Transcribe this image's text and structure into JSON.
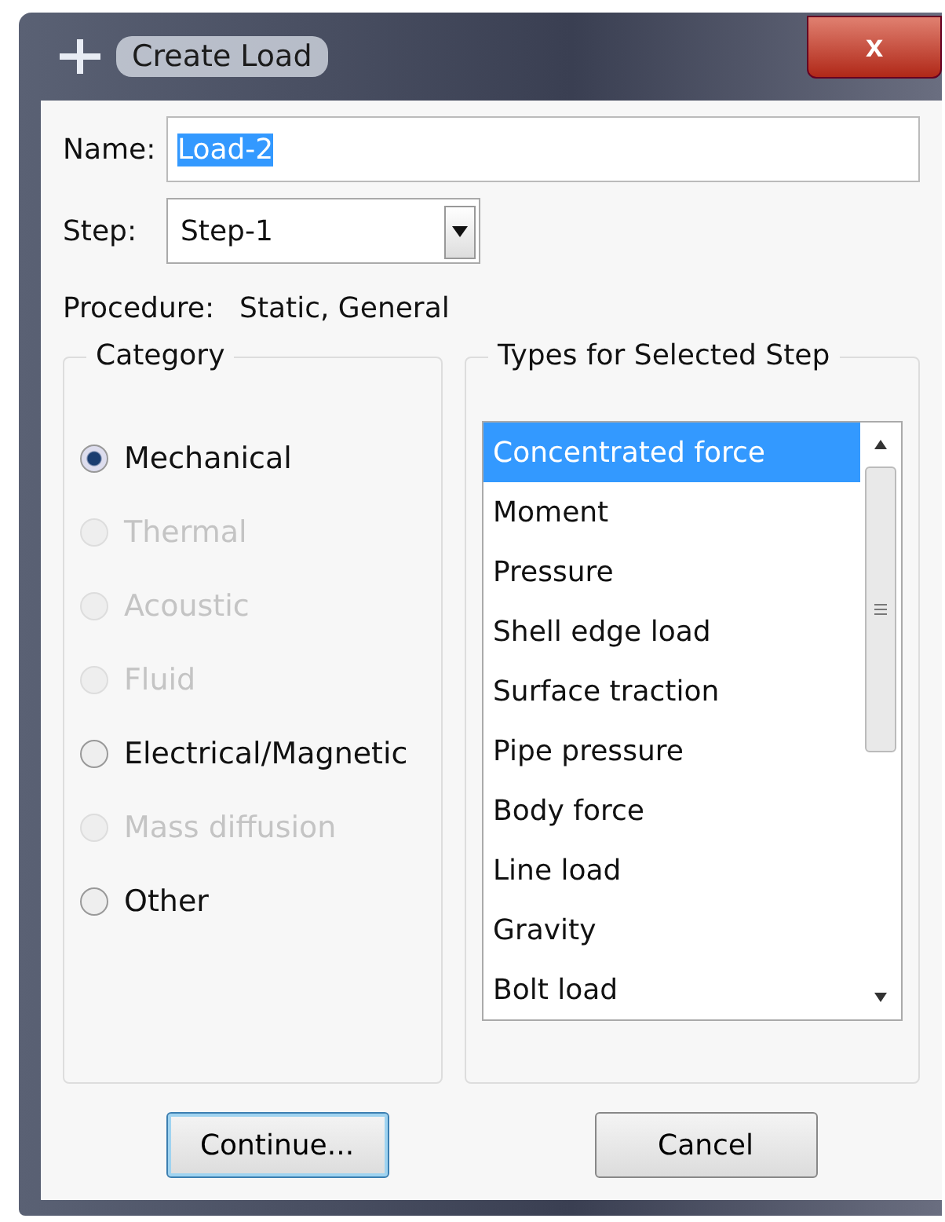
{
  "window": {
    "title": "Create Load",
    "close_label": "x"
  },
  "name": {
    "label": "Name:",
    "value": "Load-2"
  },
  "step": {
    "label": "Step:",
    "value": "Step-1"
  },
  "procedure": {
    "label": "Procedure:",
    "value": "Static, General"
  },
  "category": {
    "title": "Category",
    "options": [
      {
        "label": "Mechanical",
        "selected": true,
        "disabled": false
      },
      {
        "label": "Thermal",
        "selected": false,
        "disabled": true
      },
      {
        "label": "Acoustic",
        "selected": false,
        "disabled": true
      },
      {
        "label": "Fluid",
        "selected": false,
        "disabled": true
      },
      {
        "label": "Electrical/Magnetic",
        "selected": false,
        "disabled": false
      },
      {
        "label": "Mass diffusion",
        "selected": false,
        "disabled": true
      },
      {
        "label": "Other",
        "selected": false,
        "disabled": false
      }
    ]
  },
  "types": {
    "title": "Types for Selected Step",
    "items": [
      {
        "label": "Concentrated force",
        "selected": true
      },
      {
        "label": "Moment",
        "selected": false
      },
      {
        "label": "Pressure",
        "selected": false
      },
      {
        "label": "Shell edge load",
        "selected": false
      },
      {
        "label": "Surface traction",
        "selected": false
      },
      {
        "label": "Pipe pressure",
        "selected": false
      },
      {
        "label": "Body force",
        "selected": false
      },
      {
        "label": "Line load",
        "selected": false
      },
      {
        "label": "Gravity",
        "selected": false
      },
      {
        "label": "Bolt load",
        "selected": false
      }
    ]
  },
  "buttons": [
    {
      "label": "Continue...",
      "default": true
    },
    {
      "label": "Cancel",
      "default": false
    }
  ]
}
